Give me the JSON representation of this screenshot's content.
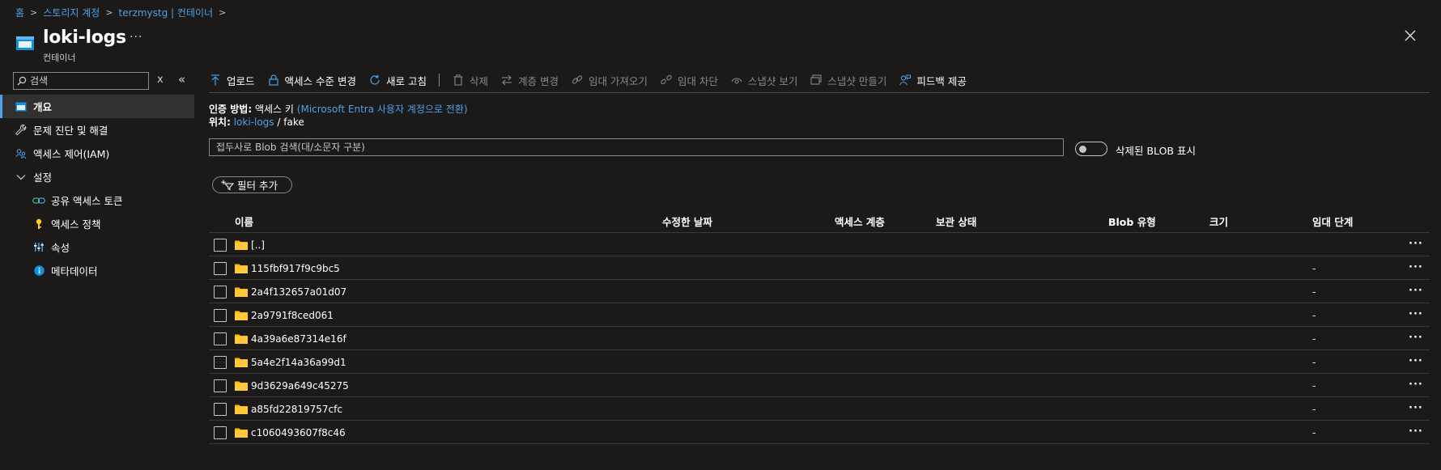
{
  "breadcrumb": [
    {
      "label": "홈"
    },
    {
      "label": "스토리지 계정"
    },
    {
      "label": "terzmystg | 컨테이너"
    }
  ],
  "header": {
    "title": "loki-logs",
    "subtitle": "컨테이너",
    "more": "···"
  },
  "sidebar": {
    "search_placeholder": "검색",
    "clear": "x",
    "collapse": "«",
    "items": [
      {
        "label": "개요",
        "icon": "overview-icon"
      },
      {
        "label": "문제 진단 및 해결",
        "icon": "wrench-icon"
      },
      {
        "label": "액세스 제어(IAM)",
        "icon": "people-icon"
      },
      {
        "label": "설정",
        "icon": "chevron-down-icon"
      },
      {
        "label": "공유 액세스 토큰",
        "icon": "link-icon"
      },
      {
        "label": "액세스 정책",
        "icon": "key-icon"
      },
      {
        "label": "속성",
        "icon": "properties-icon"
      },
      {
        "label": "메타데이터",
        "icon": "info-icon"
      }
    ]
  },
  "toolbar": {
    "upload": "업로드",
    "change_access_level": "액세스 수준 변경",
    "refresh": "새로 고침",
    "delete": "삭제",
    "change_tier": "계층 변경",
    "acquire_lease": "임대 가져오기",
    "break_lease": "임대 차단",
    "view_snapshots": "스냅샷 보기",
    "create_snapshot": "스냅샷 만들기",
    "feedback": "피드백 제공"
  },
  "auth": {
    "label": "인증 방법:",
    "value": "액세스 키",
    "switch_link": "(Microsoft Entra 사용자 계정으로 전환)"
  },
  "location": {
    "label": "위치:",
    "container": "loki-logs",
    "sep": "/",
    "path": "fake"
  },
  "blob_search": {
    "placeholder": "접두사로 Blob 검색(대/소문자 구분)"
  },
  "show_deleted": {
    "label": "삭제된 BLOB 표시",
    "on": false
  },
  "filter": {
    "label": "필터 추가"
  },
  "table": {
    "columns": [
      "이름",
      "수정한 날짜",
      "액세스 계층",
      "보관 상태",
      "Blob 유형",
      "크기",
      "임대 단계"
    ],
    "rows": [
      {
        "name": "[..]",
        "lease": ""
      },
      {
        "name": "115fbf917f9c9bc5",
        "lease": "-"
      },
      {
        "name": "2a4f132657a01d07",
        "lease": "-"
      },
      {
        "name": "2a9791f8ced061",
        "lease": "-"
      },
      {
        "name": "4a39a6e87314e16f",
        "lease": "-"
      },
      {
        "name": "5a4e2f14a36a99d1",
        "lease": "-"
      },
      {
        "name": "9d3629a649c45275",
        "lease": "-"
      },
      {
        "name": "a85fd22819757cfc",
        "lease": "-"
      },
      {
        "name": "c1060493607f8c46",
        "lease": "-"
      }
    ],
    "row_more": "···"
  },
  "colors": {
    "accent": "#4ea1e8",
    "folder": "#ffb900",
    "background": "#1b1a19"
  }
}
